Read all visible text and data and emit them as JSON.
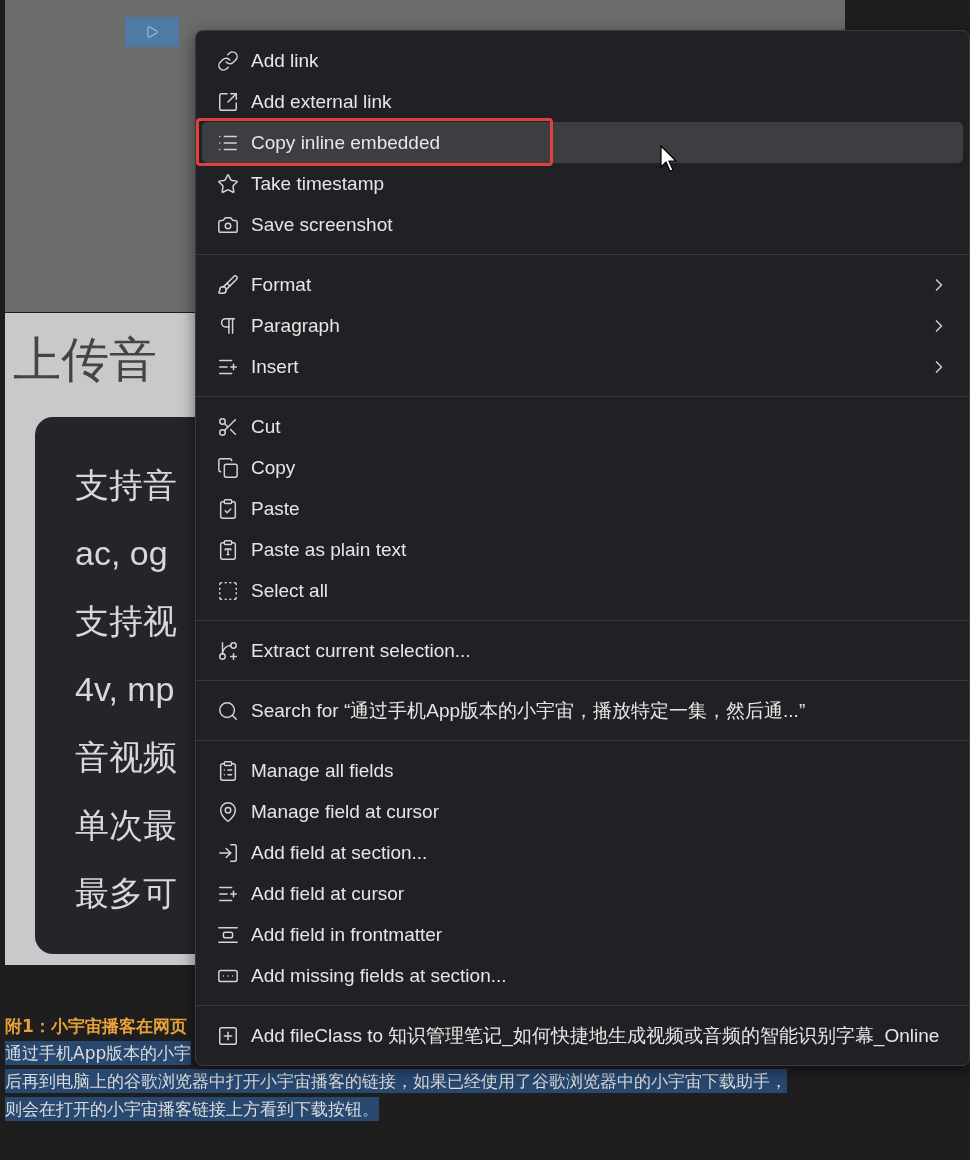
{
  "embedded_image": {
    "title": "上传音",
    "card_lines": [
      "支持音",
      "ac, og",
      "支持视",
      "4v, mp",
      "音视频",
      "单次最",
      "最多可"
    ]
  },
  "note": {
    "heading": "附1：小宇宙播客在网页",
    "lines": [
      {
        "text": "通过手机App版本的小宇",
        "selected": true
      },
      {
        "text": "后再到电脑上的谷歌浏览器中打开小宇宙播客的链接，如果已经使用了谷歌浏览器中的小宇宙下载助手，",
        "selected": true
      },
      {
        "text": "则会在打开的小宇宙播客链接上方看到下载按钮。",
        "selected": true
      }
    ]
  },
  "context_menu": {
    "sections": [
      {
        "items": [
          {
            "label": "Add link",
            "selected": false,
            "outlined": false,
            "has_submenu": false
          },
          {
            "label": "Add external link",
            "selected": false,
            "outlined": false,
            "has_submenu": false
          },
          {
            "label": "Copy inline embedded",
            "selected": true,
            "outlined": true,
            "has_submenu": false
          },
          {
            "label": "Take timestamp",
            "selected": false,
            "outlined": false,
            "has_submenu": false
          },
          {
            "label": "Save screenshot",
            "selected": false,
            "outlined": false,
            "has_submenu": false
          }
        ]
      },
      {
        "items": [
          {
            "label": "Format",
            "selected": false,
            "outlined": false,
            "has_submenu": true
          },
          {
            "label": "Paragraph",
            "selected": false,
            "outlined": false,
            "has_submenu": true
          },
          {
            "label": "Insert",
            "selected": false,
            "outlined": false,
            "has_submenu": true
          }
        ]
      },
      {
        "items": [
          {
            "label": "Cut",
            "selected": false,
            "outlined": false,
            "has_submenu": false
          },
          {
            "label": "Copy",
            "selected": false,
            "outlined": false,
            "has_submenu": false
          },
          {
            "label": "Paste",
            "selected": false,
            "outlined": false,
            "has_submenu": false
          },
          {
            "label": "Paste as plain text",
            "selected": false,
            "outlined": false,
            "has_submenu": false
          },
          {
            "label": "Select all",
            "selected": false,
            "outlined": false,
            "has_submenu": false
          }
        ]
      },
      {
        "items": [
          {
            "label": "Extract current selection...",
            "selected": false,
            "outlined": false,
            "has_submenu": false
          }
        ]
      },
      {
        "items": [
          {
            "label": "Search for “通过手机App版本的小宇宙，播放特定一集，然后通...”",
            "selected": false,
            "outlined": false,
            "has_submenu": false
          }
        ]
      },
      {
        "items": [
          {
            "label": "Manage all fields",
            "selected": false,
            "outlined": false,
            "has_submenu": false
          },
          {
            "label": "Manage field at cursor",
            "selected": false,
            "outlined": false,
            "has_submenu": false
          },
          {
            "label": "Add field at section...",
            "selected": false,
            "outlined": false,
            "has_submenu": false
          },
          {
            "label": "Add field at cursor",
            "selected": false,
            "outlined": false,
            "has_submenu": false
          },
          {
            "label": "Add field in frontmatter",
            "selected": false,
            "outlined": false,
            "has_submenu": false
          },
          {
            "label": "Add missing fields at section...",
            "selected": false,
            "outlined": false,
            "has_submenu": false
          }
        ]
      },
      {
        "items": [
          {
            "label": "Add fileClass to 知识管理笔记_如何快捷地生成视频或音频的智能识别字幕_Online",
            "selected": false,
            "outlined": false,
            "has_submenu": false
          }
        ]
      }
    ]
  }
}
